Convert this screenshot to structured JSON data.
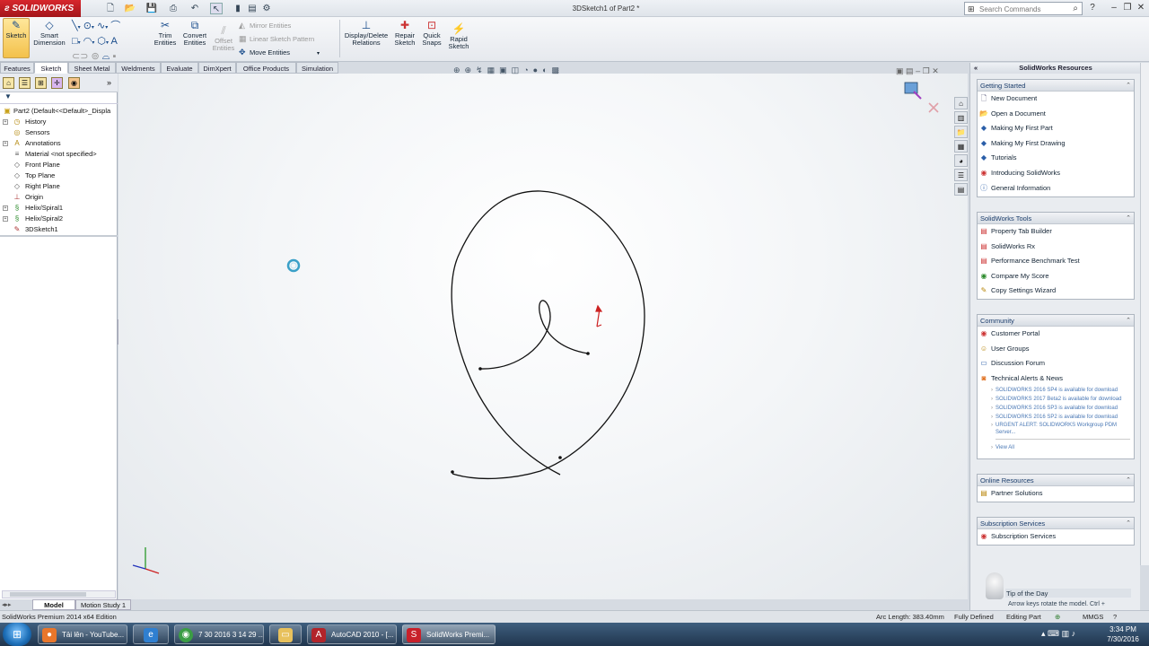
{
  "app": {
    "logo_text": "SOLIDWORKS",
    "doc_title": "3DSketch1 of Part2 *",
    "search_placeholder": "Search Commands"
  },
  "toolbar": {
    "sketch": "Sketch",
    "smart_dimension_1": "Smart",
    "smart_dimension_2": "Dimension",
    "trim_1": "Trim",
    "trim_2": "Entities",
    "convert_1": "Convert",
    "convert_2": "Entities",
    "offset_1": "Offset",
    "offset_2": "Entities",
    "mirror": "Mirror Entities",
    "linear_pattern": "Linear Sketch Pattern",
    "move": "Move Entities",
    "display_delete_1": "Display/Delete",
    "display_delete_2": "Relations",
    "repair_1": "Repair",
    "repair_2": "Sketch",
    "quick_snaps_1": "Quick",
    "quick_snaps_2": "Snaps",
    "rapid_sketch_1": "Rapid",
    "rapid_sketch_2": "Sketch"
  },
  "tabs": [
    "Features",
    "Sketch",
    "Sheet Metal",
    "Weldments",
    "Evaluate",
    "DimXpert",
    "Office Products",
    "Simulation"
  ],
  "tree": [
    {
      "label": "Part2  (Default<<Default>_Displa",
      "icon": "part-icon",
      "expand": false
    },
    {
      "label": "History",
      "icon": "history-icon",
      "expand": true
    },
    {
      "label": "Sensors",
      "icon": "sensors-icon",
      "expand": false
    },
    {
      "label": "Annotations",
      "icon": "annotations-icon",
      "expand": true
    },
    {
      "label": "Material <not specified>",
      "icon": "material-icon",
      "expand": false
    },
    {
      "label": "Front Plane",
      "icon": "plane-icon",
      "expand": false
    },
    {
      "label": "Top Plane",
      "icon": "plane-icon",
      "expand": false
    },
    {
      "label": "Right Plane",
      "icon": "plane-icon",
      "expand": false
    },
    {
      "label": "Origin",
      "icon": "origin-icon",
      "expand": false
    },
    {
      "label": "Helix/Spiral1",
      "icon": "helix-icon",
      "expand": true
    },
    {
      "label": "Helix/Spiral2",
      "icon": "helix-icon",
      "expand": true
    },
    {
      "label": "3DSketch1",
      "icon": "sketch3d-icon",
      "expand": false
    }
  ],
  "taskpane": {
    "title": "SolidWorks Resources",
    "getting_started": {
      "title": "Getting Started",
      "items": [
        "New Document",
        "Open a Document",
        "Making My First Part",
        "Making My First Drawing",
        "Tutorials",
        "Introducing SolidWorks",
        "General Information"
      ]
    },
    "tools": {
      "title": "SolidWorks Tools",
      "items": [
        "Property Tab Builder",
        "SolidWorks Rx",
        "Performance Benchmark Test",
        "Compare My Score",
        "Copy Settings Wizard"
      ]
    },
    "community": {
      "title": "Community",
      "items": [
        "Customer Portal",
        "User Groups",
        "Discussion Forum",
        "Technical Alerts & News"
      ],
      "news": [
        "SOLIDWORKS 2016 SP4 is available for download",
        "SOLIDWORKS 2017 Beta2 is available for download",
        "SOLIDWORKS 2016 SP3 is available for download",
        "SOLIDWORKS 2016 SP2 is available for download",
        "URGENT ALERT: SOLIDWORKS Workgroup PDM Server..."
      ],
      "view_all": "View All"
    },
    "online": {
      "title": "Online Resources",
      "items": [
        "Partner Solutions"
      ]
    },
    "subscription": {
      "title": "Subscription Services",
      "items": [
        "Subscription Services"
      ]
    },
    "tip_title": "Tip of the Day",
    "tip_text": "Arrow keys rotate the model. Ctrl +"
  },
  "bottom_tabs": {
    "model": "Model",
    "motion": "Motion Study 1"
  },
  "status": {
    "edition": "SolidWorks Premium 2014 x64 Edition",
    "arc_length": "Arc Length: 383.40mm",
    "defined": "Fully Defined",
    "editing": "Editing Part",
    "units": "MMGS"
  },
  "taskbar": {
    "items": [
      "Tải lên - YouTube...",
      "",
      "7 30 2016 3 14 29 ...",
      "",
      "AutoCAD 2010 - [...",
      "SolidWorks Premi..."
    ],
    "time": "3:34 PM",
    "date": "7/30/2016"
  },
  "colors": {
    "accent": "#c8202a",
    "taskbar": "#2b4662",
    "sketch_active": "#f3c14b"
  }
}
